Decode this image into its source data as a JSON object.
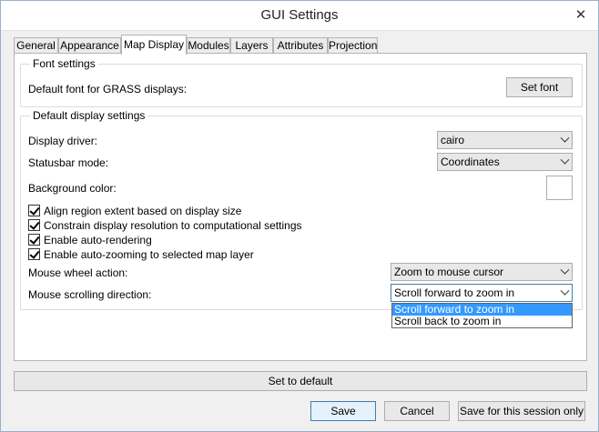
{
  "window": {
    "title": "GUI Settings",
    "close_glyph": "✕"
  },
  "tabs": [
    {
      "label": "General"
    },
    {
      "label": "Appearance"
    },
    {
      "label": "Map Display"
    },
    {
      "label": "Modules"
    },
    {
      "label": "Layers"
    },
    {
      "label": "Attributes"
    },
    {
      "label": "Projection"
    }
  ],
  "active_tab": "Map Display",
  "font_settings": {
    "title": "Font settings",
    "default_font_label": "Default font for GRASS displays:",
    "set_font_button": "Set font"
  },
  "display_settings": {
    "title": "Default display settings",
    "display_driver_label": "Display driver:",
    "display_driver_value": "cairo",
    "statusbar_mode_label": "Statusbar mode:",
    "statusbar_mode_value": "Coordinates",
    "background_color_label": "Background color:",
    "background_color_value": "#ffffff",
    "checkboxes": [
      {
        "label": "Align region extent based on display size",
        "checked": true
      },
      {
        "label": "Constrain display resolution to computational settings",
        "checked": true
      },
      {
        "label": "Enable auto-rendering",
        "checked": true
      },
      {
        "label": "Enable auto-zooming to selected map layer",
        "checked": true
      }
    ],
    "mouse_wheel_label": "Mouse wheel action:",
    "mouse_wheel_value": "Zoom to mouse cursor",
    "scroll_direction_label": "Mouse scrolling direction:",
    "scroll_direction_value": "Scroll forward to zoom in",
    "scroll_direction_options": [
      "Scroll forward to zoom in",
      "Scroll back to zoom in"
    ]
  },
  "buttons": {
    "set_default": "Set to default",
    "save": "Save",
    "cancel": "Cancel",
    "save_session": "Save for this session only"
  },
  "colors": {
    "accent": "#3399ff",
    "focus_border": "#3c7fb1"
  }
}
